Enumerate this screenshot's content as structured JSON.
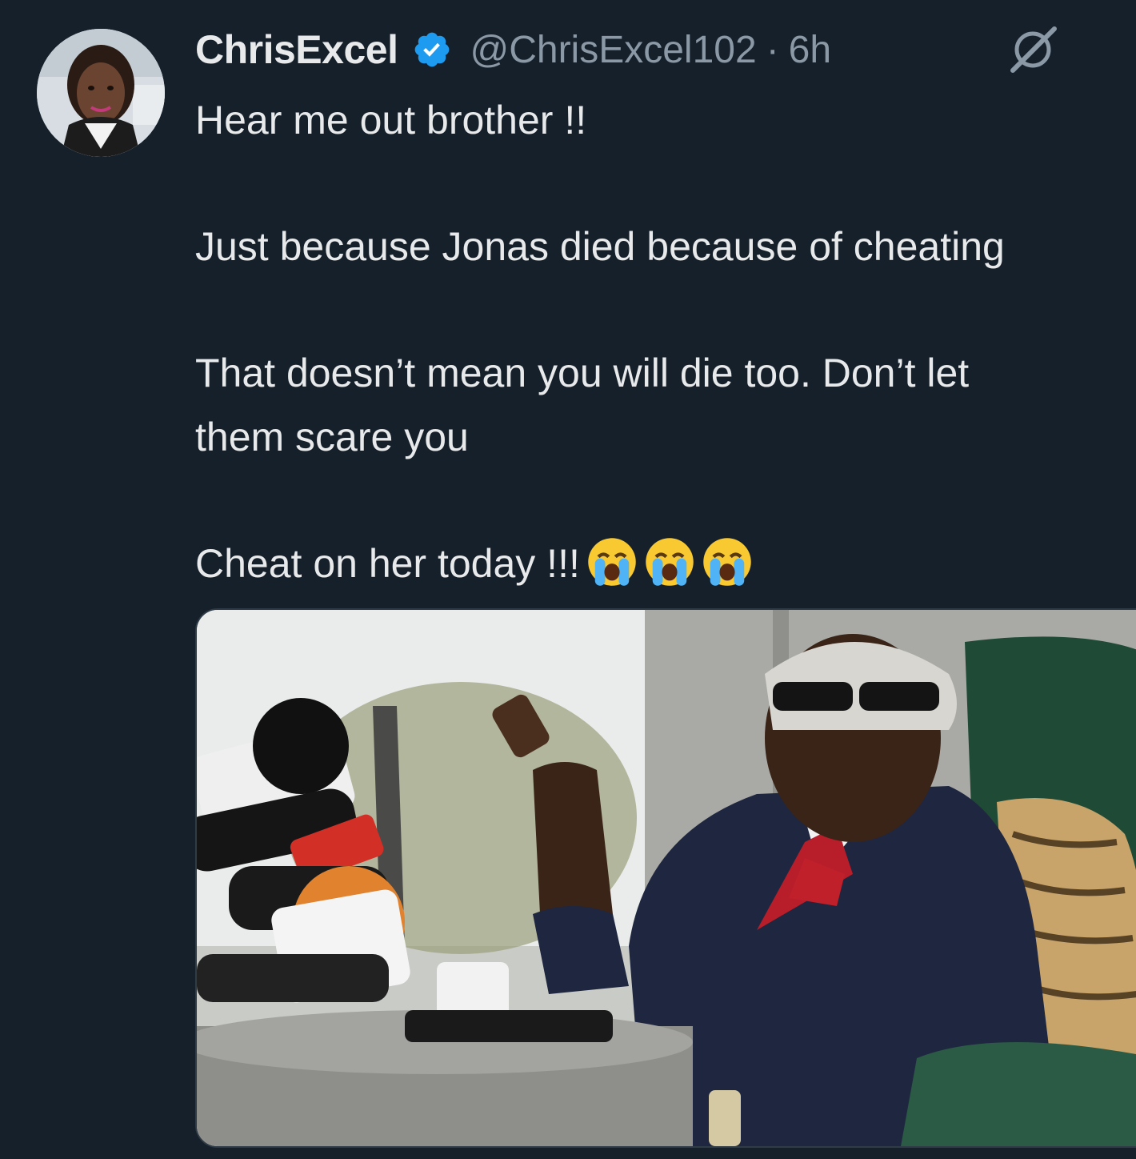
{
  "tweet": {
    "author": {
      "name": "ChrisExcel",
      "handle": "@ChrisExcel102",
      "verified": true
    },
    "timestamp": "6h",
    "separator": "·",
    "lines": [
      "Hear me out brother !!",
      "Just because Jonas died because of cheating",
      "That doesn’t mean you will die too. Don’t let",
      "them scare you",
      "Cheat on her today !!!"
    ],
    "emojis": [
      "loudly-crying-face",
      "loudly-crying-face",
      "loudly-crying-face"
    ],
    "media": {
      "type": "photo"
    }
  },
  "colors": {
    "background": "#15202b",
    "text": "#e7e9ea",
    "secondary_text": "#8b98a5",
    "verified_badge": "#1d9bf0"
  },
  "icons": {
    "verified": "verified-badge-icon",
    "grok": "grok-icon"
  }
}
